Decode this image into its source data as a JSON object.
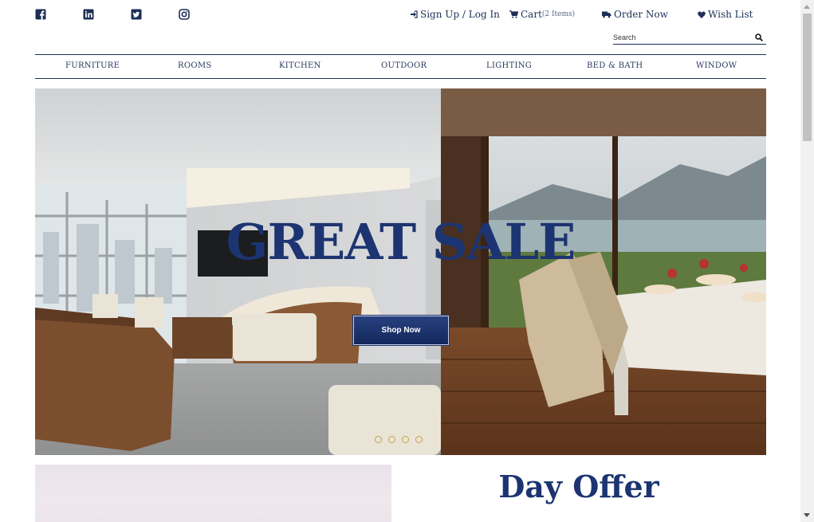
{
  "social": {
    "icons": [
      "facebook-icon",
      "linkedin-icon",
      "twitter-icon",
      "instagram-icon"
    ]
  },
  "header": {
    "signup_login": "Sign Up / Log In",
    "cart_label": "Cart",
    "cart_count": "(2 Items)",
    "order_now": "Order Now",
    "wish_list": "Wish List"
  },
  "search": {
    "placeholder": "Search"
  },
  "nav": {
    "items": [
      "FURNITURE",
      "ROOMS",
      "KITCHEN",
      "OUTDOOR",
      "LIGHTING",
      "BED & BATH",
      "WINDOW"
    ]
  },
  "hero": {
    "title": "GREAT SALE",
    "button": "Shop Now",
    "slide_count": 4
  },
  "promo": {
    "title": "Day Offer"
  },
  "colors": {
    "brand": "#1c3471",
    "text": "#1d2f57",
    "dot_accent": "#c7a24a"
  }
}
